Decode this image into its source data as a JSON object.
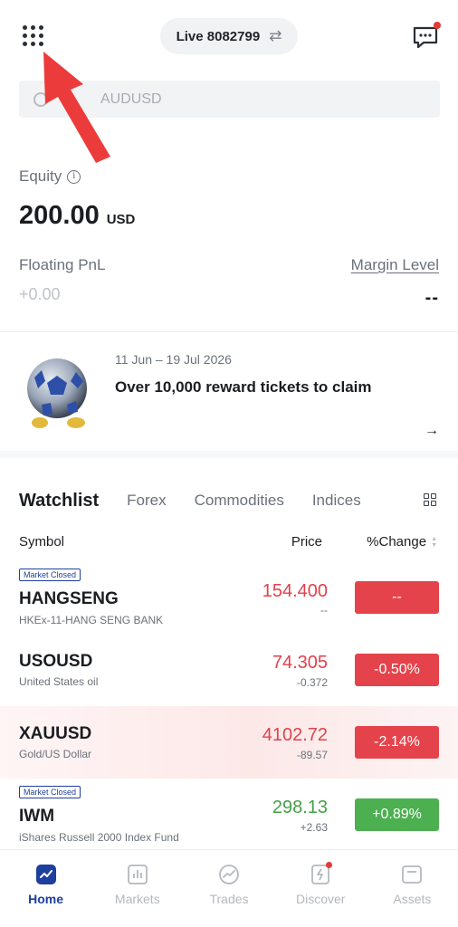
{
  "header": {
    "account_label": "Live 8082799",
    "menu_icon": "grid-menu-icon",
    "swap_icon": "swap-icon",
    "message_icon": "message-icon"
  },
  "search": {
    "placeholder": "AUDUSD"
  },
  "account": {
    "equity_label": "Equity",
    "equity_amount": "200.00",
    "equity_currency": "USD",
    "floating_pnl_label": "Floating PnL",
    "floating_pnl_value": "+0.00",
    "margin_level_label": "Margin Level",
    "margin_level_value": "--"
  },
  "promo": {
    "date_range": "11 Jun – 19 Jul 2026",
    "title": "Over 10,000 reward tickets to claim",
    "arrow": "→"
  },
  "watchlist": {
    "tabs": [
      "Watchlist",
      "Forex",
      "Commodities",
      "Indices"
    ],
    "columns": {
      "symbol": "Symbol",
      "price": "Price",
      "change": "%Change"
    },
    "rows": [
      {
        "badge": "Market Closed",
        "symbol": "HANGSENG",
        "description": "HKEx-11-HANG SENG BANK",
        "price": "154.400",
        "change": "--",
        "pct": "--",
        "direction": "down"
      },
      {
        "badge": "",
        "symbol": "USOUSD",
        "description": "United States oil",
        "price": "74.305",
        "change": "-0.372",
        "pct": "-0.50%",
        "direction": "down"
      },
      {
        "badge": "",
        "symbol": "XAUUSD",
        "description": "Gold/US Dollar",
        "price": "4102.72",
        "change": "-89.57",
        "pct": "-2.14%",
        "direction": "down"
      },
      {
        "badge": "Market Closed",
        "symbol": "IWM",
        "description": "iShares Russell 2000 Index Fund",
        "price": "298.13",
        "change": "+2.63",
        "pct": "+0.89%",
        "direction": "up"
      }
    ]
  },
  "nav": {
    "items": [
      "Home",
      "Markets",
      "Trades",
      "Discover",
      "Assets"
    ]
  },
  "colors": {
    "accent": "#1f3f9e",
    "down": "#e5434b",
    "up": "#4caf50"
  }
}
